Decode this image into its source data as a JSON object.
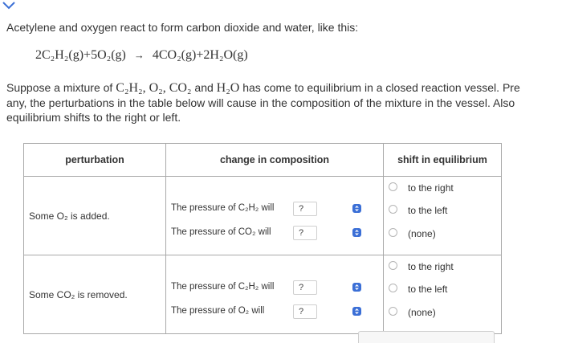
{
  "intro": "Acetylene and oxygen react to form carbon dioxide and water, like this:",
  "equation": {
    "reactants": "2C₂H₂(g)+5O₂(g)",
    "arrow": "→",
    "products": "4CO₂(g)+2H₂O(g)"
  },
  "question": {
    "line1_start": "Suppose a mixture of",
    "line1_species": "C₂H₂, O₂, CO₂",
    "line1_and": "and",
    "line1_species2": "H₂O",
    "line1_end": "has come to equilibrium in a closed reaction vessel. Pre",
    "line2": "any, the perturbations in the table below will cause in the composition of the mixture in the vessel. Also",
    "line3": "equilibrium shifts to the right or left."
  },
  "table": {
    "headers": {
      "perturbation": "perturbation",
      "change": "change in composition",
      "shift": "shift in equilibrium"
    },
    "rows": [
      {
        "perturbation": "Some O₂ is added.",
        "changes": [
          {
            "label": "The pressure of C₂H₂ will",
            "value": "?"
          },
          {
            "label": "The pressure of CO₂ will",
            "value": "?"
          }
        ],
        "options": [
          "to the right",
          "to the left",
          "(none)"
        ]
      },
      {
        "perturbation": "Some CO₂ is removed.",
        "changes": [
          {
            "label": "The pressure of C₂H₂ will",
            "value": "?"
          },
          {
            "label": "The pressure of O₂ will",
            "value": "?"
          }
        ],
        "options": [
          "to the right",
          "to the left",
          "(none)"
        ]
      }
    ]
  },
  "colors": {
    "accent": "#3b6fd6",
    "border": "#a9a9a9",
    "text": "#333333"
  },
  "icons": {
    "collapse": "chevron-down-icon",
    "stepper": "up-down-stepper-icon"
  }
}
